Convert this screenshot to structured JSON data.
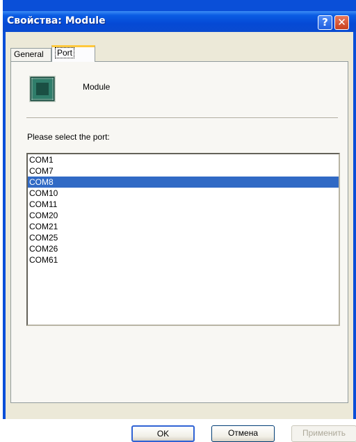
{
  "window": {
    "title": "Свойства: Module"
  },
  "titlebar": {
    "help_glyph": "?",
    "close_glyph": "✕"
  },
  "tabs": [
    {
      "label": "General",
      "active": false
    },
    {
      "label": "Port",
      "active": true
    }
  ],
  "device": {
    "icon": "chip-icon",
    "name": "Module"
  },
  "port_prompt": "Please select the port:",
  "ports": [
    "COM1",
    "COM7",
    "COM8",
    "COM10",
    "COM11",
    "COM20",
    "COM21",
    "COM25",
    "COM26",
    "COM61"
  ],
  "selected_port": "COM8",
  "colors": {
    "selection": "#316ac5",
    "titlebar": "#0a4bd0",
    "tab_highlight": "#ffc83c"
  },
  "buttons": {
    "ok": "OK",
    "cancel": "Отмена",
    "apply": "Применить",
    "apply_enabled": false
  }
}
